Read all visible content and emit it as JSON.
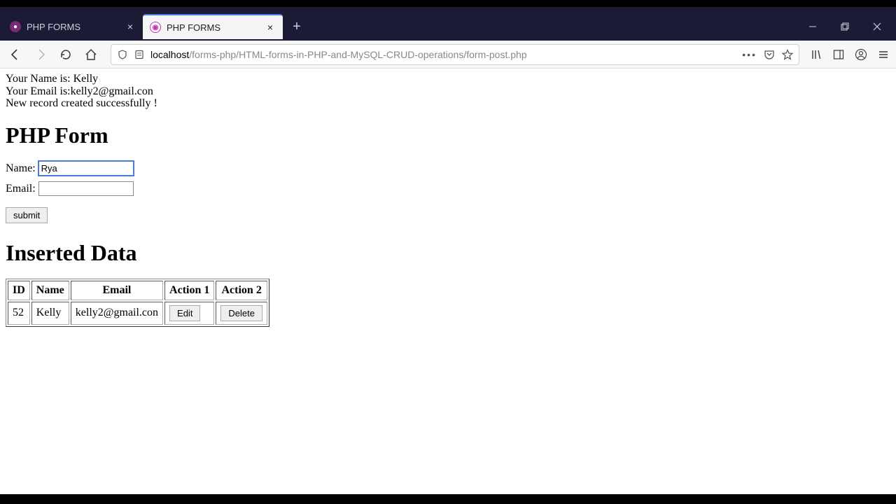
{
  "browser": {
    "tabs": [
      {
        "title": "PHP FORMS",
        "active": false
      },
      {
        "title": "PHP FORMS",
        "active": true
      }
    ],
    "url_prefix": "localhost",
    "url_rest": "/forms-php/HTML-forms-in-PHP-and-MySQL-CRUD-operations/form-post.php"
  },
  "messages": {
    "line1_pre": "Your Name is: ",
    "line1_val": "Kelly",
    "line2_pre": "Your Email is:",
    "line2_val": "kelly2@gmail.con",
    "line3": "New record created successfully !"
  },
  "form": {
    "heading": "PHP Form",
    "name_label": "Name: ",
    "name_value": "Rya",
    "email_label": "Email: ",
    "email_value": "",
    "submit_label": "submit"
  },
  "table": {
    "heading": "Inserted Data",
    "headers": [
      "ID",
      "Name",
      "Email",
      "Action 1",
      "Action 2"
    ],
    "edit_label": "Edit",
    "delete_label": "Delete",
    "rows": [
      {
        "id": "52",
        "name": "Kelly",
        "email": "kelly2@gmail.con"
      }
    ]
  }
}
